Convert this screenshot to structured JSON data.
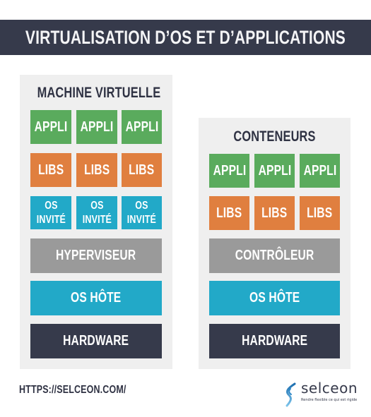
{
  "title": "VIRTUALISATION D’OS ET D’APPLICATIONS",
  "colors": {
    "header": "#363a4b",
    "panel": "#efefef",
    "appli": "#5aab5d",
    "libs": "#e07f3f",
    "os": "#22a9c8",
    "middleware": "#9a9a9a",
    "hardware": "#363a4b"
  },
  "left": {
    "title": "MACHINE VIRTUELLE",
    "apps": [
      "APPLI",
      "APPLI",
      "APPLI"
    ],
    "libs": [
      "LIBS",
      "LIBS",
      "LIBS"
    ],
    "guest_os": [
      {
        "line1": "OS",
        "line2": "INVITÉ"
      },
      {
        "line1": "OS",
        "line2": "INVITÉ"
      },
      {
        "line1": "OS",
        "line2": "INVITÉ"
      }
    ],
    "middleware": "HYPERVISEUR",
    "host_os": "OS HÔTE",
    "hardware": "HARDWARE"
  },
  "right": {
    "title": "CONTENEURS",
    "apps": [
      "APPLI",
      "APPLI",
      "APPLI"
    ],
    "libs": [
      "LIBS",
      "LIBS",
      "LIBS"
    ],
    "middleware": "CONTRÔLEUR",
    "host_os": "OS HÔTE",
    "hardware": "HARDWARE"
  },
  "footer": {
    "url": "HTTPS://SELCEON.COM/",
    "logo_name": "selceon",
    "logo_tagline": "Rendre flexible ce qui est rigide",
    "logo_icon": "s-swirl-icon"
  }
}
